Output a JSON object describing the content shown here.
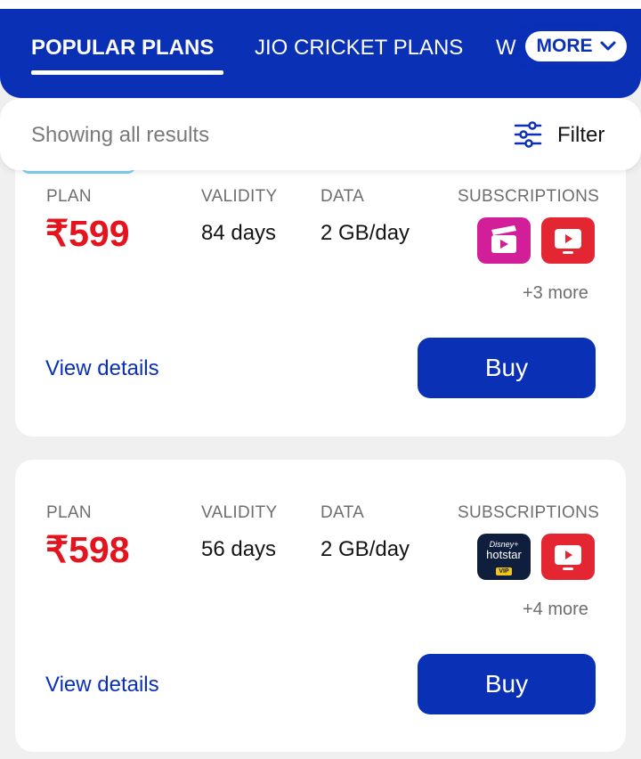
{
  "tabs": {
    "popular": "POPULAR PLANS",
    "cricket": "JIO CRICKET PLANS",
    "partial": "W",
    "more": "MORE"
  },
  "filterbar": {
    "results_text": "Showing all results",
    "filter_label": "Filter"
  },
  "headers": {
    "plan": "PLAN",
    "validity": "VALIDITY",
    "data": "DATA",
    "subscriptions": "SUBSCRIPTIONS"
  },
  "plans": [
    {
      "price": "₹599",
      "validity": "84 days",
      "data": "2 GB/day",
      "subscriptions": [
        "cinema-app-icon",
        "tv-app-icon"
      ],
      "more": "+3 more",
      "view_details": "View details",
      "buy": "Buy"
    },
    {
      "price": "₹598",
      "validity": "56 days",
      "data": "2 GB/day",
      "subscriptions": [
        "disney-hotstar-icon",
        "tv-app-icon"
      ],
      "hotstar_text": {
        "line1": "Disney+",
        "line2": "hotstar",
        "line3": "VIP"
      },
      "more": "+4 more",
      "view_details": "View details",
      "buy": "Buy"
    }
  ],
  "colors": {
    "brand_blue": "#0a30b6",
    "price_red": "#e4141e",
    "cinema_pink": "#d21f99",
    "tv_red": "#e42632"
  }
}
